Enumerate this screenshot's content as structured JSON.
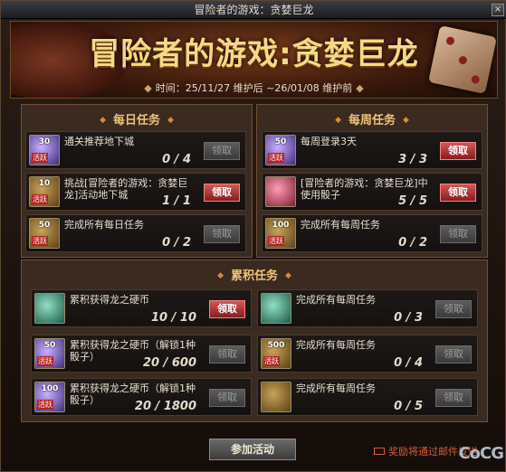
{
  "window": {
    "title": "冒险者的游戏：贪婪巨龙",
    "close_glyph": "×"
  },
  "banner": {
    "title": "冒险者的游戏:贪婪巨龙",
    "time": "时间：25/11/27 维护后 ~26/01/08 维护前"
  },
  "daily": {
    "title": "每日任务",
    "tasks": [
      {
        "name": "通关推荐地下城",
        "progress": "0 / 4",
        "icon_num": "30",
        "icon_tag": "活跃",
        "button": "领取",
        "enabled": false
      },
      {
        "name": "挑战[冒险者的游戏：贪婪巨龙]活动地下城",
        "progress": "1 / 1",
        "icon_num": "10",
        "icon_tag": "活跃",
        "button": "领取",
        "enabled": true
      },
      {
        "name": "完成所有每日任务",
        "progress": "0 / 2",
        "icon_num": "50",
        "icon_tag": "活跃",
        "button": "领取",
        "enabled": false
      }
    ]
  },
  "weekly": {
    "title": "每周任务",
    "tasks": [
      {
        "name": "每周登录3天",
        "progress": "3 / 3",
        "icon_num": "50",
        "icon_tag": "活跃",
        "button": "领取",
        "enabled": true
      },
      {
        "name": "[冒险者的游戏：贪婪巨龙]中使用骰子",
        "progress": "5 / 5",
        "icon_num": "",
        "icon_tag": "",
        "button": "领取",
        "enabled": true
      },
      {
        "name": "完成所有每周任务",
        "progress": "0 / 2",
        "icon_num": "100",
        "icon_tag": "活跃",
        "button": "领取",
        "enabled": false
      }
    ]
  },
  "cumulative": {
    "title": "累积任务",
    "tasks": [
      {
        "name": "累积获得龙之硬币",
        "progress": "10 / 10",
        "icon_num": "",
        "icon_tag": "",
        "button": "领取",
        "enabled": true
      },
      {
        "name": "完成所有每周任务",
        "progress": "0 / 3",
        "icon_num": "",
        "icon_tag": "",
        "button": "领取",
        "enabled": false
      },
      {
        "name": "累积获得龙之硬币（解锁1种骰子）",
        "progress": "20 / 600",
        "icon_num": "50",
        "icon_tag": "活跃",
        "button": "领取",
        "enabled": false
      },
      {
        "name": "完成所有每周任务",
        "progress": "0 / 4",
        "icon_num": "500",
        "icon_tag": "活跃",
        "button": "领取",
        "enabled": false
      },
      {
        "name": "累积获得龙之硬币（解锁1种骰子）",
        "progress": "20 / 1800",
        "icon_num": "100",
        "icon_tag": "活跃",
        "button": "领取",
        "enabled": false
      },
      {
        "name": "完成所有每周任务",
        "progress": "0 / 5",
        "icon_num": "",
        "icon_tag": "",
        "button": "领取",
        "enabled": false
      }
    ]
  },
  "footer": {
    "join_button": "参加活动",
    "mail_note": "奖励将通过邮件发送",
    "logo": "CoCG"
  }
}
